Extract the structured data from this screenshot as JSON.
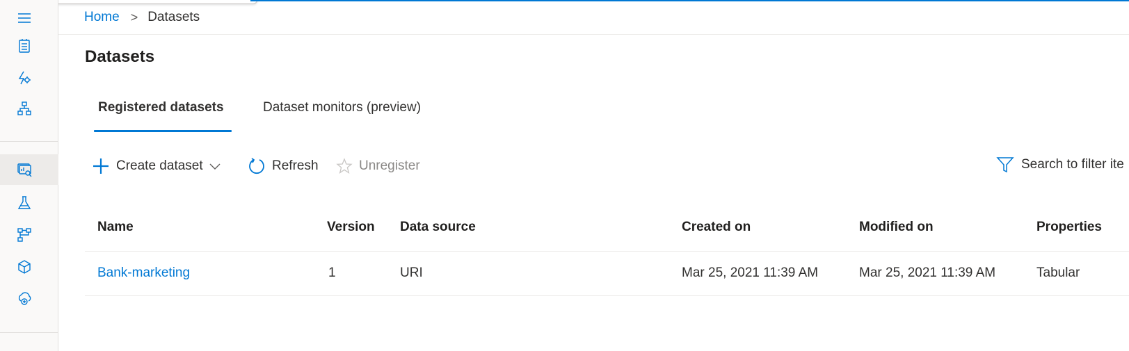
{
  "breadcrumb": {
    "home": "Home",
    "separator": ">",
    "current": "Datasets"
  },
  "page": {
    "title": "Datasets"
  },
  "tabs": [
    {
      "label": "Registered datasets",
      "active": true
    },
    {
      "label": "Dataset monitors (preview)",
      "active": false
    }
  ],
  "toolbar": {
    "create_label": "Create dataset",
    "refresh_label": "Refresh",
    "unregister_label": "Unregister",
    "filter_placeholder": "Search to filter ite"
  },
  "table": {
    "columns": [
      "Name",
      "Version",
      "Data source",
      "Created on",
      "Modified on",
      "Properties"
    ],
    "rows": [
      {
        "name": "Bank-marketing",
        "version": "1",
        "data_source": "URI",
        "created_on": "Mar 25, 2021 11:39 AM",
        "modified_on": "Mar 25, 2021 11:39 AM",
        "properties": "Tabular"
      }
    ]
  },
  "sidebar": {
    "icons": [
      "hamburger-icon",
      "notebook-icon",
      "automl-icon",
      "designer-icon",
      "datasets-icon",
      "experiments-icon",
      "pipelines-icon",
      "models-icon",
      "endpoints-icon"
    ],
    "active": "datasets-icon"
  },
  "colors": {
    "accent": "#0078d4",
    "sidebar_bg": "#faf9f8",
    "active_bg": "#edebe9"
  }
}
